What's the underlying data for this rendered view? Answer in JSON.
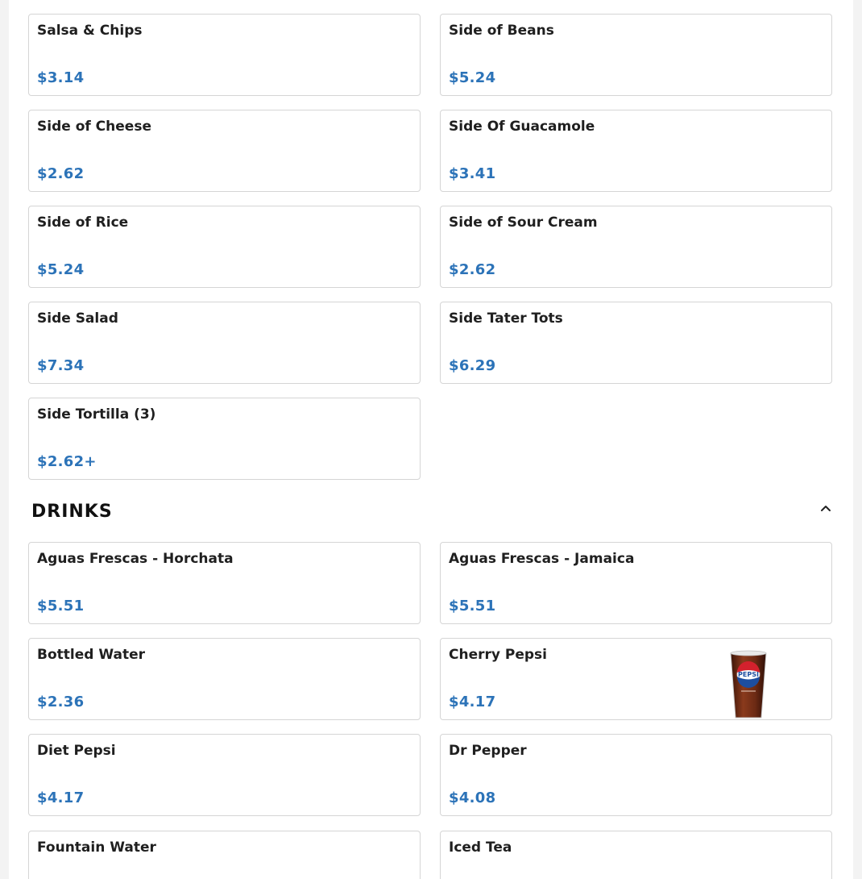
{
  "sides": {
    "items": [
      {
        "name": "Salsa & Chips",
        "price": "$3.14"
      },
      {
        "name": "Side of Beans",
        "price": "$5.24"
      },
      {
        "name": "Side of Cheese",
        "price": "$2.62"
      },
      {
        "name": "Side Of Guacamole",
        "price": "$3.41"
      },
      {
        "name": "Side of Rice",
        "price": "$5.24"
      },
      {
        "name": "Side of Sour Cream",
        "price": "$2.62"
      },
      {
        "name": "Side Salad",
        "price": "$7.34"
      },
      {
        "name": "Side Tater Tots",
        "price": "$6.29"
      },
      {
        "name": "Side Tortilla (3)",
        "price": "$2.62+"
      }
    ]
  },
  "drinks": {
    "title": "DRINKS",
    "toggle_icon": "chevron-up-icon",
    "items": [
      {
        "name": "Aguas Frescas - Horchata",
        "price": "$5.51"
      },
      {
        "name": "Aguas Frescas - Jamaica",
        "price": "$5.51"
      },
      {
        "name": "Bottled Water",
        "price": "$2.36"
      },
      {
        "name": "Cherry Pepsi",
        "price": "$4.17",
        "image": "pepsi-cup-image",
        "image_text": "PEPSI"
      },
      {
        "name": "Diet Pepsi",
        "price": "$4.17"
      },
      {
        "name": "Dr Pepper",
        "price": "$4.08"
      },
      {
        "name": "Fountain Water",
        "price": ""
      },
      {
        "name": "Iced Tea",
        "price": ""
      }
    ]
  },
  "colors": {
    "price": "#2c73b8",
    "border": "#d5d5d5",
    "pepsi_blue": "#1d4ea0",
    "pepsi_red": "#d3212d",
    "cola": "#6b2a14"
  }
}
